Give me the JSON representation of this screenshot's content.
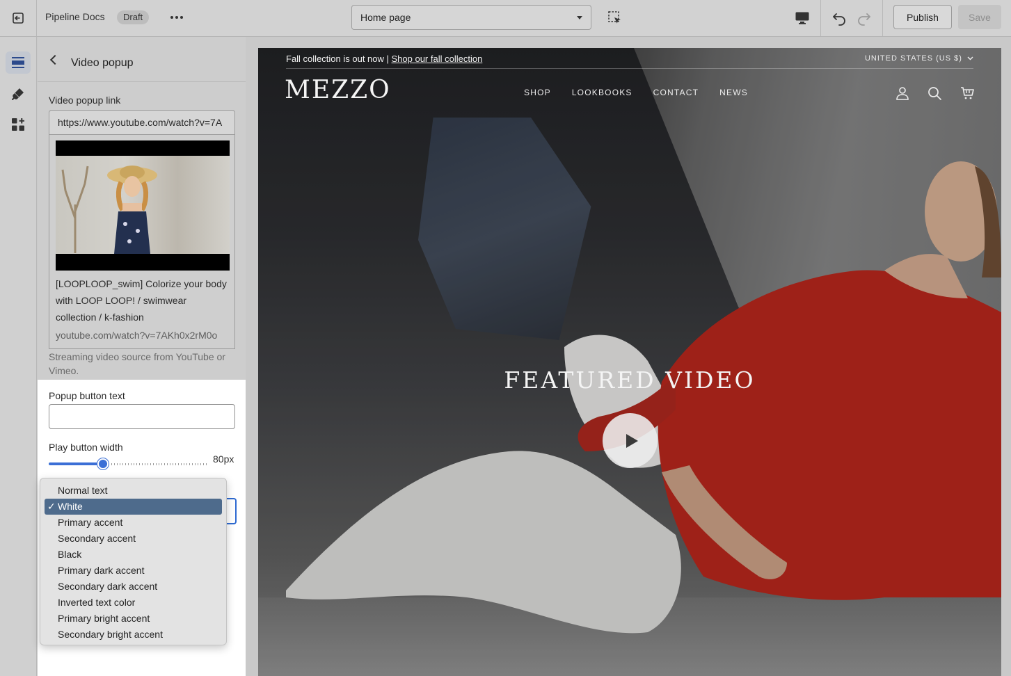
{
  "topbar": {
    "store_name": "Pipeline Docs",
    "status_badge": "Draft",
    "template_select": "Home page",
    "publish_label": "Publish",
    "save_label": "Save"
  },
  "rail": {
    "items": [
      {
        "icon": "sections-icon",
        "active": true
      },
      {
        "icon": "theme-settings-icon",
        "active": false
      },
      {
        "icon": "apps-icon",
        "active": false
      }
    ]
  },
  "panel": {
    "title": "Video popup",
    "video_link": {
      "label": "Video popup link",
      "value": "https://www.youtube.com/watch?v=7A",
      "embed_title": "[LOOPLOOP_swim] Colorize your body with LOOP LOOP! / swimwear collection / k-fashion",
      "embed_url": "youtube.com/watch?v=7AKh0x2rM0o",
      "help": "Streaming video source from YouTube or Vimeo."
    },
    "popup_button_text": {
      "label": "Popup button text",
      "value": ""
    },
    "play_button_width": {
      "label": "Play button width",
      "value_label": "80px",
      "fraction": 0.34
    }
  },
  "color_menu": {
    "selected": "White",
    "options": [
      "Normal text",
      "White",
      "Primary accent",
      "Secondary accent",
      "Black",
      "Primary dark accent",
      "Secondary dark accent",
      "Inverted text color",
      "Primary bright accent",
      "Secondary bright accent"
    ]
  },
  "preview": {
    "announcement_text": "Fall collection is out now | ",
    "announcement_link": "Shop our fall collection",
    "country": "UNITED STATES (US $)",
    "logo": "MEZZO",
    "nav": [
      "SHOP",
      "LOOKBOOKS",
      "CONTACT",
      "NEWS"
    ],
    "hero_title": "FEATURED VIDEO"
  },
  "colors": {
    "accent": "#3b6fd6",
    "menu_selected": "#4e6b8c"
  }
}
